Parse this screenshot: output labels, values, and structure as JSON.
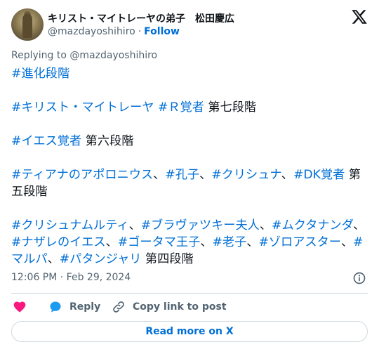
{
  "author": {
    "display_name": "キリスト・マイトレーヤの弟子　松田慶広",
    "handle": "@mazdayoshihiro",
    "separator": "·",
    "follow_label": "Follow"
  },
  "replying_to": {
    "prefix": "Replying to ",
    "handle": "@mazdayoshihiro"
  },
  "tweet": {
    "p1": {
      "t1": "#進化段階"
    },
    "p2": {
      "t1": "#キリスト・マイトレーヤ",
      "s1": " ",
      "t2": "#Ｒ覚者",
      "s2": " 第七段階"
    },
    "p3": {
      "t1": "#イエス覚者",
      "s1": " 第六段階"
    },
    "p4": {
      "t1": "#ティアナのアポロニウス",
      "s1": "、",
      "t2": "#孔子",
      "s2": "、",
      "t3": "#クリシュナ",
      "s3": "、",
      "t4": "#DK覚者",
      "s4": " 第五段階"
    },
    "p5": {
      "t1": "#クリシュナムルティ",
      "s1": "、",
      "t2": "#ブラヴァツキー夫人",
      "s2": "、",
      "t3": "#ムクタナンダ",
      "s3": "、",
      "t4": "#ナザレのイエス",
      "s4": "、",
      "t5": "#ゴータマ王子",
      "s5": "、",
      "t6": "#老子",
      "s6": "、",
      "t7": "#ゾロアスター",
      "s7": "、",
      "t8": "#マルパ",
      "s8": "、",
      "t9": "#パタンジャリ",
      "s9": " 第四段階"
    }
  },
  "timestamp": "12:06 PM · Feb 29, 2024",
  "actions": {
    "reply_label": "Reply",
    "copy_label": "Copy link to post"
  },
  "read_more_label": "Read more on X",
  "colors": {
    "link": "#006fd6",
    "heart": "#f91880",
    "reply_bubble": "#1d9bf0",
    "muted": "#536471"
  }
}
